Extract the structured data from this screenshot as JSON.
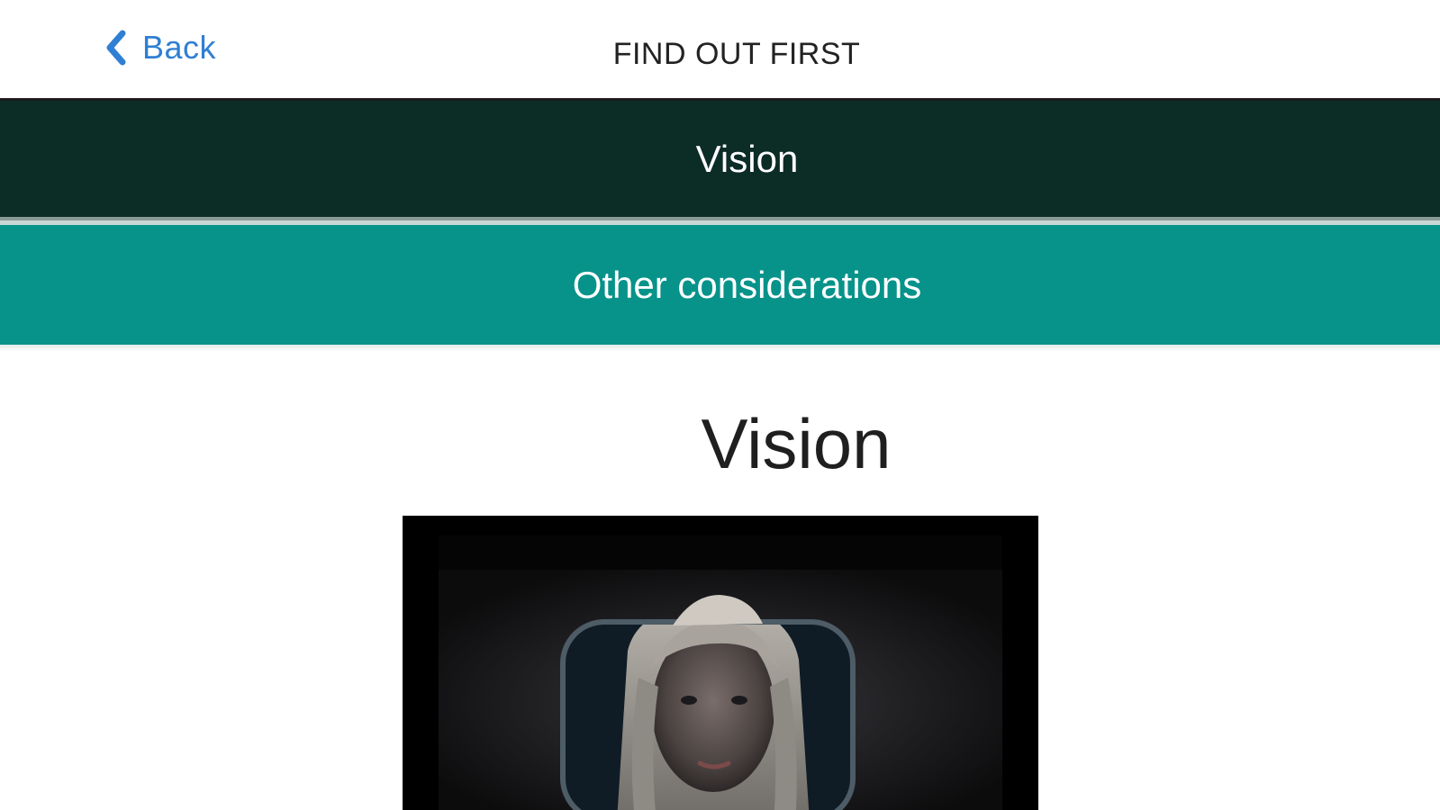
{
  "nav": {
    "back_label": "Back",
    "title": "FIND OUT FIRST",
    "back_icon": "chevron-left-icon"
  },
  "tabs": [
    {
      "label": "Vision",
      "state": "selected",
      "color": "#0c2c26"
    },
    {
      "label": "Other considerations",
      "state": "default",
      "color": "#07938a"
    }
  ],
  "content": {
    "heading": "Vision"
  },
  "colors": {
    "accent_link": "#2f7fd3",
    "tab_selected": "#0c2c26",
    "tab_default": "#07938a",
    "text_dark": "#1f1f1f"
  }
}
